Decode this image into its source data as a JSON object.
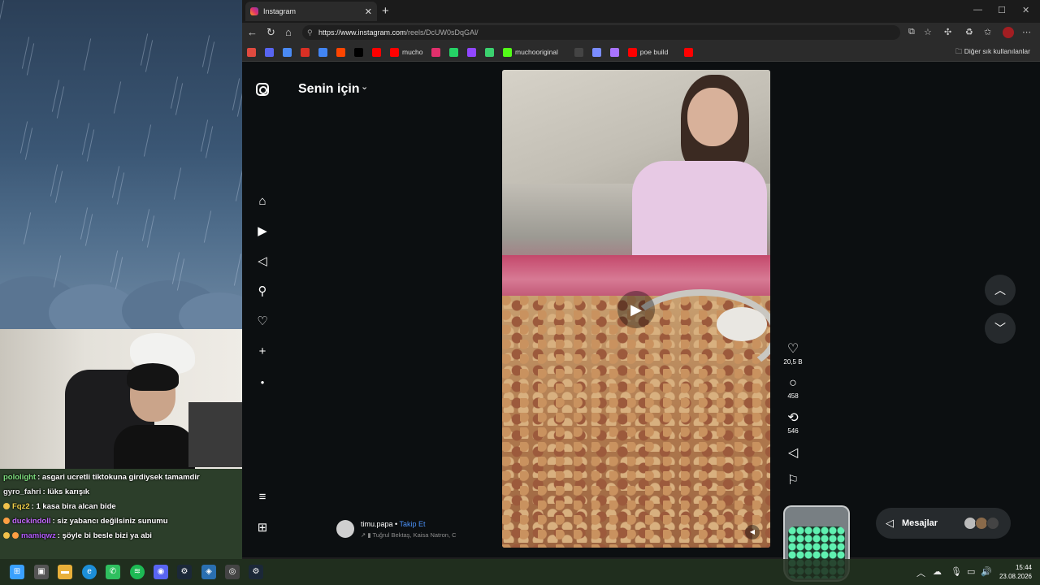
{
  "browser": {
    "tab_title": "Instagram",
    "url_domain": "https://www.instagram.com",
    "url_path": "/reels/DcUW0sDqGAl/",
    "bookmarks": [
      {
        "label": "",
        "icon": "gmail-icon"
      },
      {
        "label": "",
        "icon": "discord-icon"
      },
      {
        "label": "",
        "icon": "translate-icon"
      },
      {
        "label": "",
        "icon": "gmail-m-icon"
      },
      {
        "label": "",
        "icon": "google-icon"
      },
      {
        "label": "",
        "icon": "reddit-icon"
      },
      {
        "label": "",
        "icon": "x-icon"
      },
      {
        "label": "",
        "icon": "youtube-icon"
      },
      {
        "label": "mucho",
        "icon": "youtube-icon"
      },
      {
        "label": "",
        "icon": "instagram-icon"
      },
      {
        "label": "",
        "icon": "whatsapp-icon"
      },
      {
        "label": "",
        "icon": "twitch-icon"
      },
      {
        "label": "",
        "icon": "puzzle-icon"
      },
      {
        "label": "muchooriginal",
        "icon": "kick-icon"
      },
      {
        "label": "",
        "icon": "chatgpt-icon"
      },
      {
        "label": "",
        "icon": "link-icon"
      },
      {
        "label": "",
        "icon": "feather-icon"
      },
      {
        "label": "poe build",
        "icon": "youtube-icon"
      },
      {
        "label": "",
        "icon": "youtube-icon"
      }
    ],
    "other_bookmarks": "Diğer sık kullanılanlar"
  },
  "instagram": {
    "feed_title": "Senin için",
    "actions": {
      "likes": "20,5 B",
      "comments": "458",
      "reposts": "546"
    },
    "author": {
      "username": "timu.papa",
      "separator": "•",
      "follow_label": "Takip Et",
      "audio": "Tuğrul Bektaş, Kaisa Natron, C"
    },
    "messages_label": "Mesajlar"
  },
  "chat": [
    {
      "user": "pololight",
      "text": ": asgari ucretli tiktokuna girdiysek tamamdir",
      "color": "#7ee07e",
      "badges": []
    },
    {
      "user": "gyro_fahri",
      "text": ": lüks karışık",
      "color": "#e8e8e8",
      "badges": []
    },
    {
      "user": "Fqz2",
      "text": ": 1 kasa bira alcan bide",
      "color": "#f2d24b",
      "badges": [
        "#f2c14b"
      ]
    },
    {
      "user": "duckindoll",
      "text": ": siz yabancı değilsiniz sunumu",
      "color": "#c56bff",
      "badges": [
        "#ff9f43"
      ]
    },
    {
      "user": "mamiqwz",
      "text": ": şöyle bi besle bizi ya abi",
      "color": "#b45cff",
      "badges": [
        "#f2c14b",
        "#ff9f43"
      ]
    }
  ],
  "taskbar": {
    "time": "15:44",
    "date": "23.08.2026"
  }
}
